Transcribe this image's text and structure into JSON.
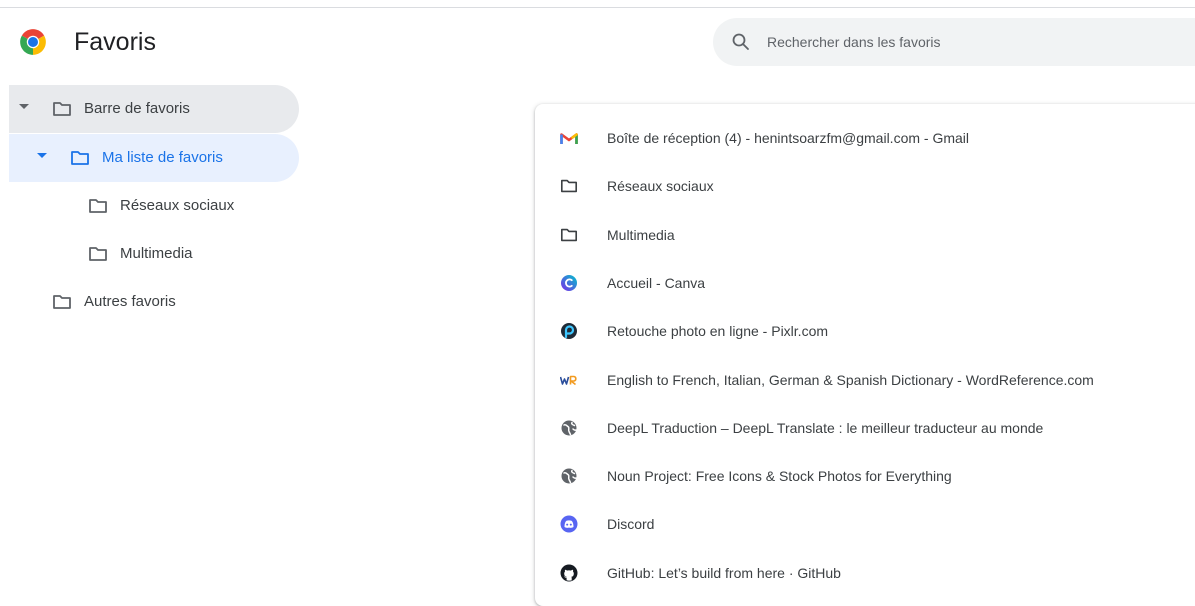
{
  "header": {
    "title": "Favoris",
    "logo_icon": "chrome-logo-icon",
    "search_placeholder": "Rechercher dans les favoris"
  },
  "colors": {
    "accent": "#1a73e8",
    "selected_bg": "#e8f0fe",
    "hover_bg": "#e8eaed",
    "search_bg": "#f1f3f4"
  },
  "sidebar": {
    "tree": [
      {
        "label": "Barre de favoris",
        "expanded": true,
        "state": "hover"
      },
      {
        "label": "Ma liste de favoris",
        "expanded": true,
        "state": "selected"
      },
      {
        "label": "Réseaux sociaux"
      },
      {
        "label": "Multimedia"
      },
      {
        "label": "Autres favoris"
      }
    ]
  },
  "list": {
    "items": [
      {
        "label": "Boîte de réception (4) - henintsoarzfm@gmail.com - Gmail",
        "icon": "gmail-icon"
      },
      {
        "label": "Réseaux sociaux",
        "icon": "folder-icon"
      },
      {
        "label": "Multimedia",
        "icon": "folder-icon"
      },
      {
        "label": "Accueil - Canva",
        "icon": "canva-icon"
      },
      {
        "label": "Retouche photo en ligne - Pixlr.com",
        "icon": "pixlr-icon"
      },
      {
        "label": "English to French, Italian, German & Spanish Dictionary - WordReference.com",
        "icon": "wordreference-icon"
      },
      {
        "label": "DeepL Traduction – DeepL Translate : le meilleur traducteur au monde",
        "icon": "globe-icon"
      },
      {
        "label": "Noun Project: Free Icons & Stock Photos for Everything",
        "icon": "globe-icon"
      },
      {
        "label": "Discord",
        "icon": "discord-icon"
      },
      {
        "label": "GitHub: Let’s build from here · GitHub",
        "icon": "github-icon"
      }
    ]
  }
}
